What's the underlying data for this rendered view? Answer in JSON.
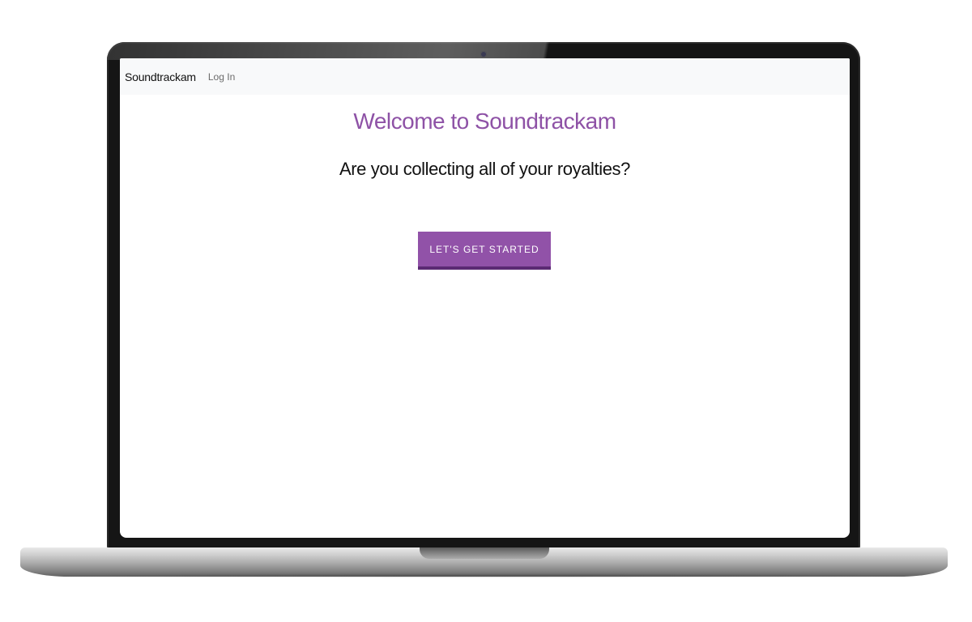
{
  "navbar": {
    "brand": "Soundtrackam",
    "login_label": "Log In"
  },
  "hero": {
    "title": "Welcome to Soundtrackam",
    "subtitle": "Are you collecting all of your royalties?",
    "cta_label": "LET'S GET STARTED"
  },
  "colors": {
    "accent": "#9152a8",
    "title": "#8e52a6",
    "navbar_bg": "#f8f9fa"
  }
}
